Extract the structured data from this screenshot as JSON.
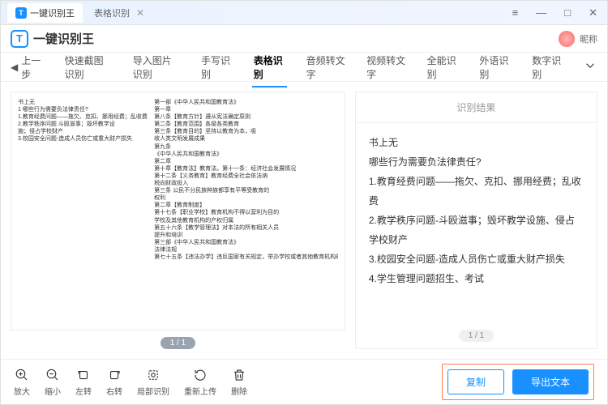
{
  "titlebar": {
    "app_name": "一键识别王",
    "tab_name": "表格识别",
    "menu": "≡",
    "min": "—",
    "max": "□",
    "close": "✕"
  },
  "header": {
    "logo_letter": "T",
    "title": "一键识别王",
    "nickname": "昵称"
  },
  "nav": {
    "back": "上一步",
    "items": [
      "快速截图识别",
      "导入图片识别",
      "手写识别",
      "表格识别",
      "音频转文字",
      "视频转文字",
      "全能识别",
      "外语识别",
      "数字识别"
    ],
    "active_index": 3,
    "more": "⋯"
  },
  "preview": {
    "page": "1 / 1",
    "left_lines": [
      "书上无",
      "1 哪些行为需要负法律责任?",
      "1.教育经费问题——拖欠、克扣、挪用经费；乱收费",
      "2.教学秩序问题 斗殴滋事；毁坏教学设",
      "施；侵占学校财产",
      "3.校园安全问题-造成人员伤亡或重大财产损失"
    ],
    "right_lines": [
      "第一部《中华人民共和国教育法》",
      "第一章",
      "第八条【教育方针】遵从宪法确定原则",
      "第二条【教育范围】各级各类教育",
      "第三条【教育目的】坚持以教育为本，吸",
      "收人类文明发展成果",
      "第九条",
      "《中华人民共和国教育法》",
      "第二章",
      "第十章【教育法】教育法。第十一条：经济社会发展情况",
      "第十二条【义务教育】教育经费全社会依法纳",
      "税向财政投入",
      "第三条 公民不分民族种族都享有平等受教育的",
      "权利",
      "第二章【教育制度】",
      "第十七条【职业学校】教育机构不得以营利为目的",
      "学校及其他教育机构的产权归属",
      "第五十六条【教学管理法】对本法的所有相关人员",
      "提升和培训",
      "第三部《中华人民共和国教育法》",
      "法律法规",
      "第七十五条【违法办学】违反国家有关规定，举办学校或者其他教育机构的"
    ]
  },
  "result": {
    "head": "识别结果",
    "lines": [
      "书上无",
      "哪些行为需要负法律责任?",
      "1.教育经费问题——拖欠、克扣、挪用经费；乱收费",
      "2.教学秩序问题-斗殴滋事；毁坏教学设施、侵占学校财产",
      "3.校园安全问题-造成人员伤亡或重大财产损失",
      "4.学生管理问题招生、考试"
    ],
    "page": "1 / 1"
  },
  "tools": {
    "zoom_in": "放大",
    "zoom_out": "缩小",
    "rotate_left": "左转",
    "rotate_right": "右转",
    "crop": "局部识别",
    "reupload": "重新上传",
    "delete": "删除"
  },
  "actions": {
    "copy": "复制",
    "export": "导出文本"
  }
}
